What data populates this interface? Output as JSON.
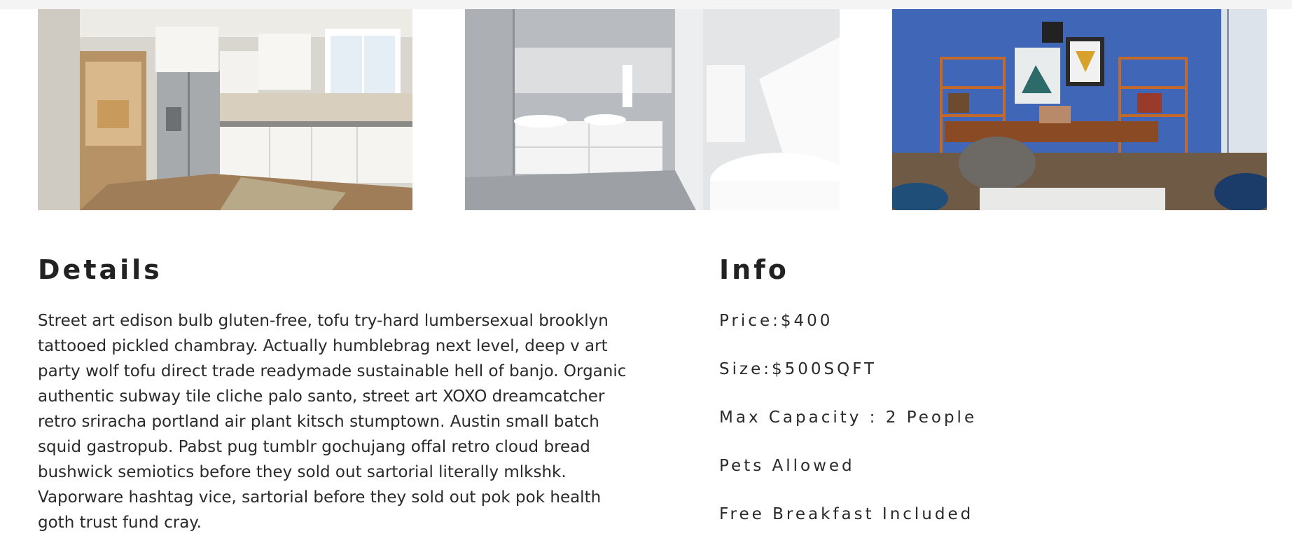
{
  "images": [
    {
      "name": "kitchen-photo",
      "alt": "Kitchen"
    },
    {
      "name": "bathroom-photo",
      "alt": "Bathroom"
    },
    {
      "name": "office-photo",
      "alt": "Living room office"
    }
  ],
  "details": {
    "heading": "Details",
    "body": "Street art edison bulb gluten-free, tofu try-hard lumbersexual brooklyn tattooed pickled chambray. Actually humblebrag next level, deep v art party wolf tofu direct trade readymade sustainable hell of banjo. Organic authentic subway tile cliche palo santo, street art XOXO dreamcatcher retro sriracha portland air plant kitsch stumptown. Austin small batch squid gastropub. Pabst pug tumblr gochujang offal retro cloud bread bushwick semiotics before they sold out sartorial literally mlkshk. Vaporware hashtag vice, sartorial before they sold out pok pok health goth trust fund cray."
  },
  "info": {
    "heading": "Info",
    "items": [
      "Price:$400",
      "Size:$500SQFT",
      "Max Capacity : 2 People",
      "Pets Allowed",
      "Free Breakfast Included"
    ]
  }
}
